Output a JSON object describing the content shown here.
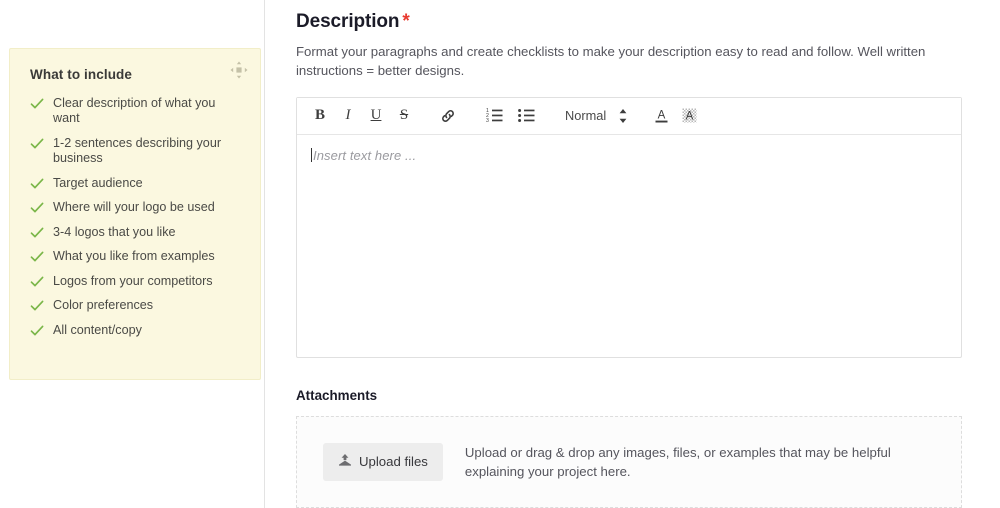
{
  "sidebar": {
    "title": "What to include",
    "drag_handle_icon": "move-handle-icon",
    "check_color": "#7ab648",
    "background": "#fbf8e0",
    "items": [
      {
        "label": "Clear description of what you want"
      },
      {
        "label": "1-2 sentences describing your business"
      },
      {
        "label": "Target audience"
      },
      {
        "label": "Where will your logo be used"
      },
      {
        "label": "3-4 logos that you like"
      },
      {
        "label": "What you like from examples"
      },
      {
        "label": "Logos from your competitors"
      },
      {
        "label": "Color preferences"
      },
      {
        "label": "All content/copy"
      }
    ]
  },
  "description": {
    "title": "Description",
    "required_marker": "*",
    "required_color": "#e8392f",
    "help_text": "Format your paragraphs and create checklists to make your description easy to read and follow. Well written instructions = better designs."
  },
  "editor": {
    "placeholder": "Insert text here ...",
    "value": "",
    "toolbar": [
      {
        "name": "bold-icon",
        "label": "B"
      },
      {
        "name": "italic-icon",
        "label": "I"
      },
      {
        "name": "underline-icon",
        "label": "U"
      },
      {
        "name": "strikethrough-icon",
        "label": "S"
      },
      {
        "name": "link-icon",
        "label": ""
      },
      {
        "name": "ordered-list-icon",
        "label": ""
      },
      {
        "name": "bullet-list-icon",
        "label": ""
      }
    ],
    "style_select": {
      "value": "Normal",
      "options": [
        "Normal"
      ],
      "icon": "updown-stepper-icon"
    },
    "text_color_icon": "text-color-icon",
    "background_color_icon": "text-background-color-icon"
  },
  "attachments": {
    "title": "Attachments",
    "upload_button": {
      "label": "Upload files",
      "icon": "upload-icon"
    },
    "hint": "Upload or drag & drop any images, files, or examples that may be helpful explaining your project here."
  }
}
